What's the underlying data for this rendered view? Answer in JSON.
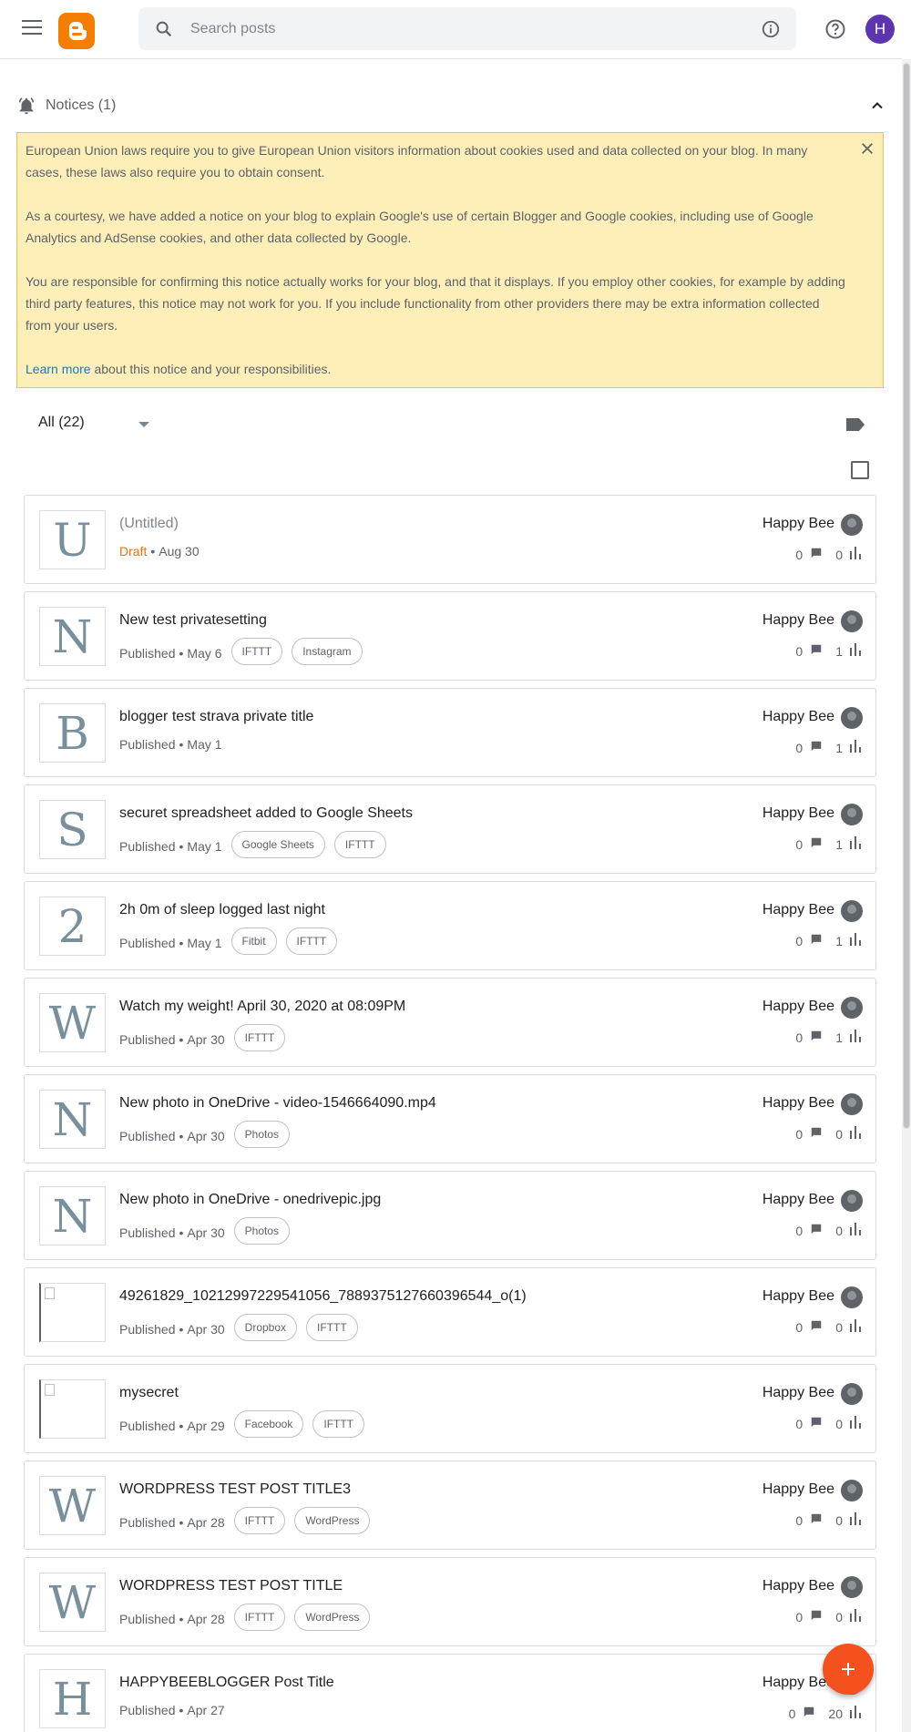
{
  "header": {
    "search_placeholder": "Search posts",
    "account_initial": "H"
  },
  "notices": {
    "title": "Notices (1)",
    "para1": "European Union laws require you to give European Union visitors information about cookies used and data collected on your blog. In many cases, these laws also require you to obtain consent.",
    "para2": "As a courtesy, we have added a notice on your blog to explain Google's use of certain Blogger and Google cookies, including use of Google Analytics and AdSense cookies, and other data collected by Google.",
    "para3": "You are responsible for confirming this notice actually works for your blog, and that it displays. If you employ other cookies, for example by adding third party features, this notice may not work for you. If you include functionality from other providers there may be extra information collected from your users.",
    "learn_more": "Learn more",
    "learn_more_rest": " about this notice and your responsibilities."
  },
  "filter": {
    "label": "All (22)"
  },
  "colors": {
    "brand": "#f57d00",
    "draft": "#e8710a",
    "notice_bg": "#feefb8",
    "fab": "#f4511e",
    "account": "#5e35b1"
  },
  "posts": [
    {
      "initial": "U",
      "title": "(Untitled)",
      "status": "Draft",
      "date": "Aug 30",
      "labels": [],
      "author": "Happy Bee",
      "comments": "0",
      "views": "0"
    },
    {
      "initial": "N",
      "title": "New test privatesetting",
      "status": "Published",
      "date": "May 6",
      "labels": [
        "IFTTT",
        "Instagram"
      ],
      "author": "Happy Bee",
      "comments": "0",
      "views": "1"
    },
    {
      "initial": "B",
      "title": "blogger test strava private title",
      "status": "Published",
      "date": "May 1",
      "labels": [],
      "author": "Happy Bee",
      "comments": "0",
      "views": "1"
    },
    {
      "initial": "S",
      "title": "securet spreadsheet added to Google Sheets",
      "status": "Published",
      "date": "May 1",
      "labels": [
        "Google Sheets",
        "IFTTT"
      ],
      "author": "Happy Bee",
      "comments": "0",
      "views": "1"
    },
    {
      "initial": "2",
      "title": "2h 0m of sleep logged last night",
      "status": "Published",
      "date": "May 1",
      "labels": [
        "Fitbit",
        "IFTTT"
      ],
      "author": "Happy Bee",
      "comments": "0",
      "views": "1"
    },
    {
      "initial": "W",
      "title": "Watch my weight! April 30, 2020 at 08:09PM",
      "status": "Published",
      "date": "Apr 30",
      "labels": [
        "IFTTT"
      ],
      "author": "Happy Bee",
      "comments": "0",
      "views": "1"
    },
    {
      "initial": "N",
      "title": "New photo in OneDrive - video-1546664090.mp4",
      "status": "Published",
      "date": "Apr 30",
      "labels": [
        "Photos"
      ],
      "author": "Happy Bee",
      "comments": "0",
      "views": "0"
    },
    {
      "initial": "N",
      "title": "New photo in OneDrive - onedrivepic.jpg",
      "status": "Published",
      "date": "Apr 30",
      "labels": [
        "Photos"
      ],
      "author": "Happy Bee",
      "comments": "0",
      "views": "0"
    },
    {
      "initial": "",
      "title": "49261829_10212997229541056_7889375127660396544_o(1)",
      "status": "Published",
      "date": "Apr 30",
      "labels": [
        "Dropbox",
        "IFTTT"
      ],
      "author": "Happy Bee",
      "comments": "0",
      "views": "0"
    },
    {
      "initial": "",
      "title": "mysecret",
      "status": "Published",
      "date": "Apr 29",
      "labels": [
        "Facebook",
        "IFTTT"
      ],
      "author": "Happy Bee",
      "comments": "0",
      "views": "0"
    },
    {
      "initial": "W",
      "title": "WORDPRESS TEST POST TITLE3",
      "status": "Published",
      "date": "Apr 28",
      "labels": [
        "IFTTT",
        "WordPress"
      ],
      "author": "Happy Bee",
      "comments": "0",
      "views": "0"
    },
    {
      "initial": "W",
      "title": "WORDPRESS TEST POST TITLE",
      "status": "Published",
      "date": "Apr 28",
      "labels": [
        "IFTTT",
        "WordPress"
      ],
      "author": "Happy Bee",
      "comments": "0",
      "views": "0"
    },
    {
      "initial": "H",
      "title": "HAPPYBEEBLOGGER Post Title",
      "status": "Published",
      "date": "Apr 27",
      "labels": [],
      "author": "Happy Bee",
      "comments": "0",
      "views": "20"
    }
  ]
}
